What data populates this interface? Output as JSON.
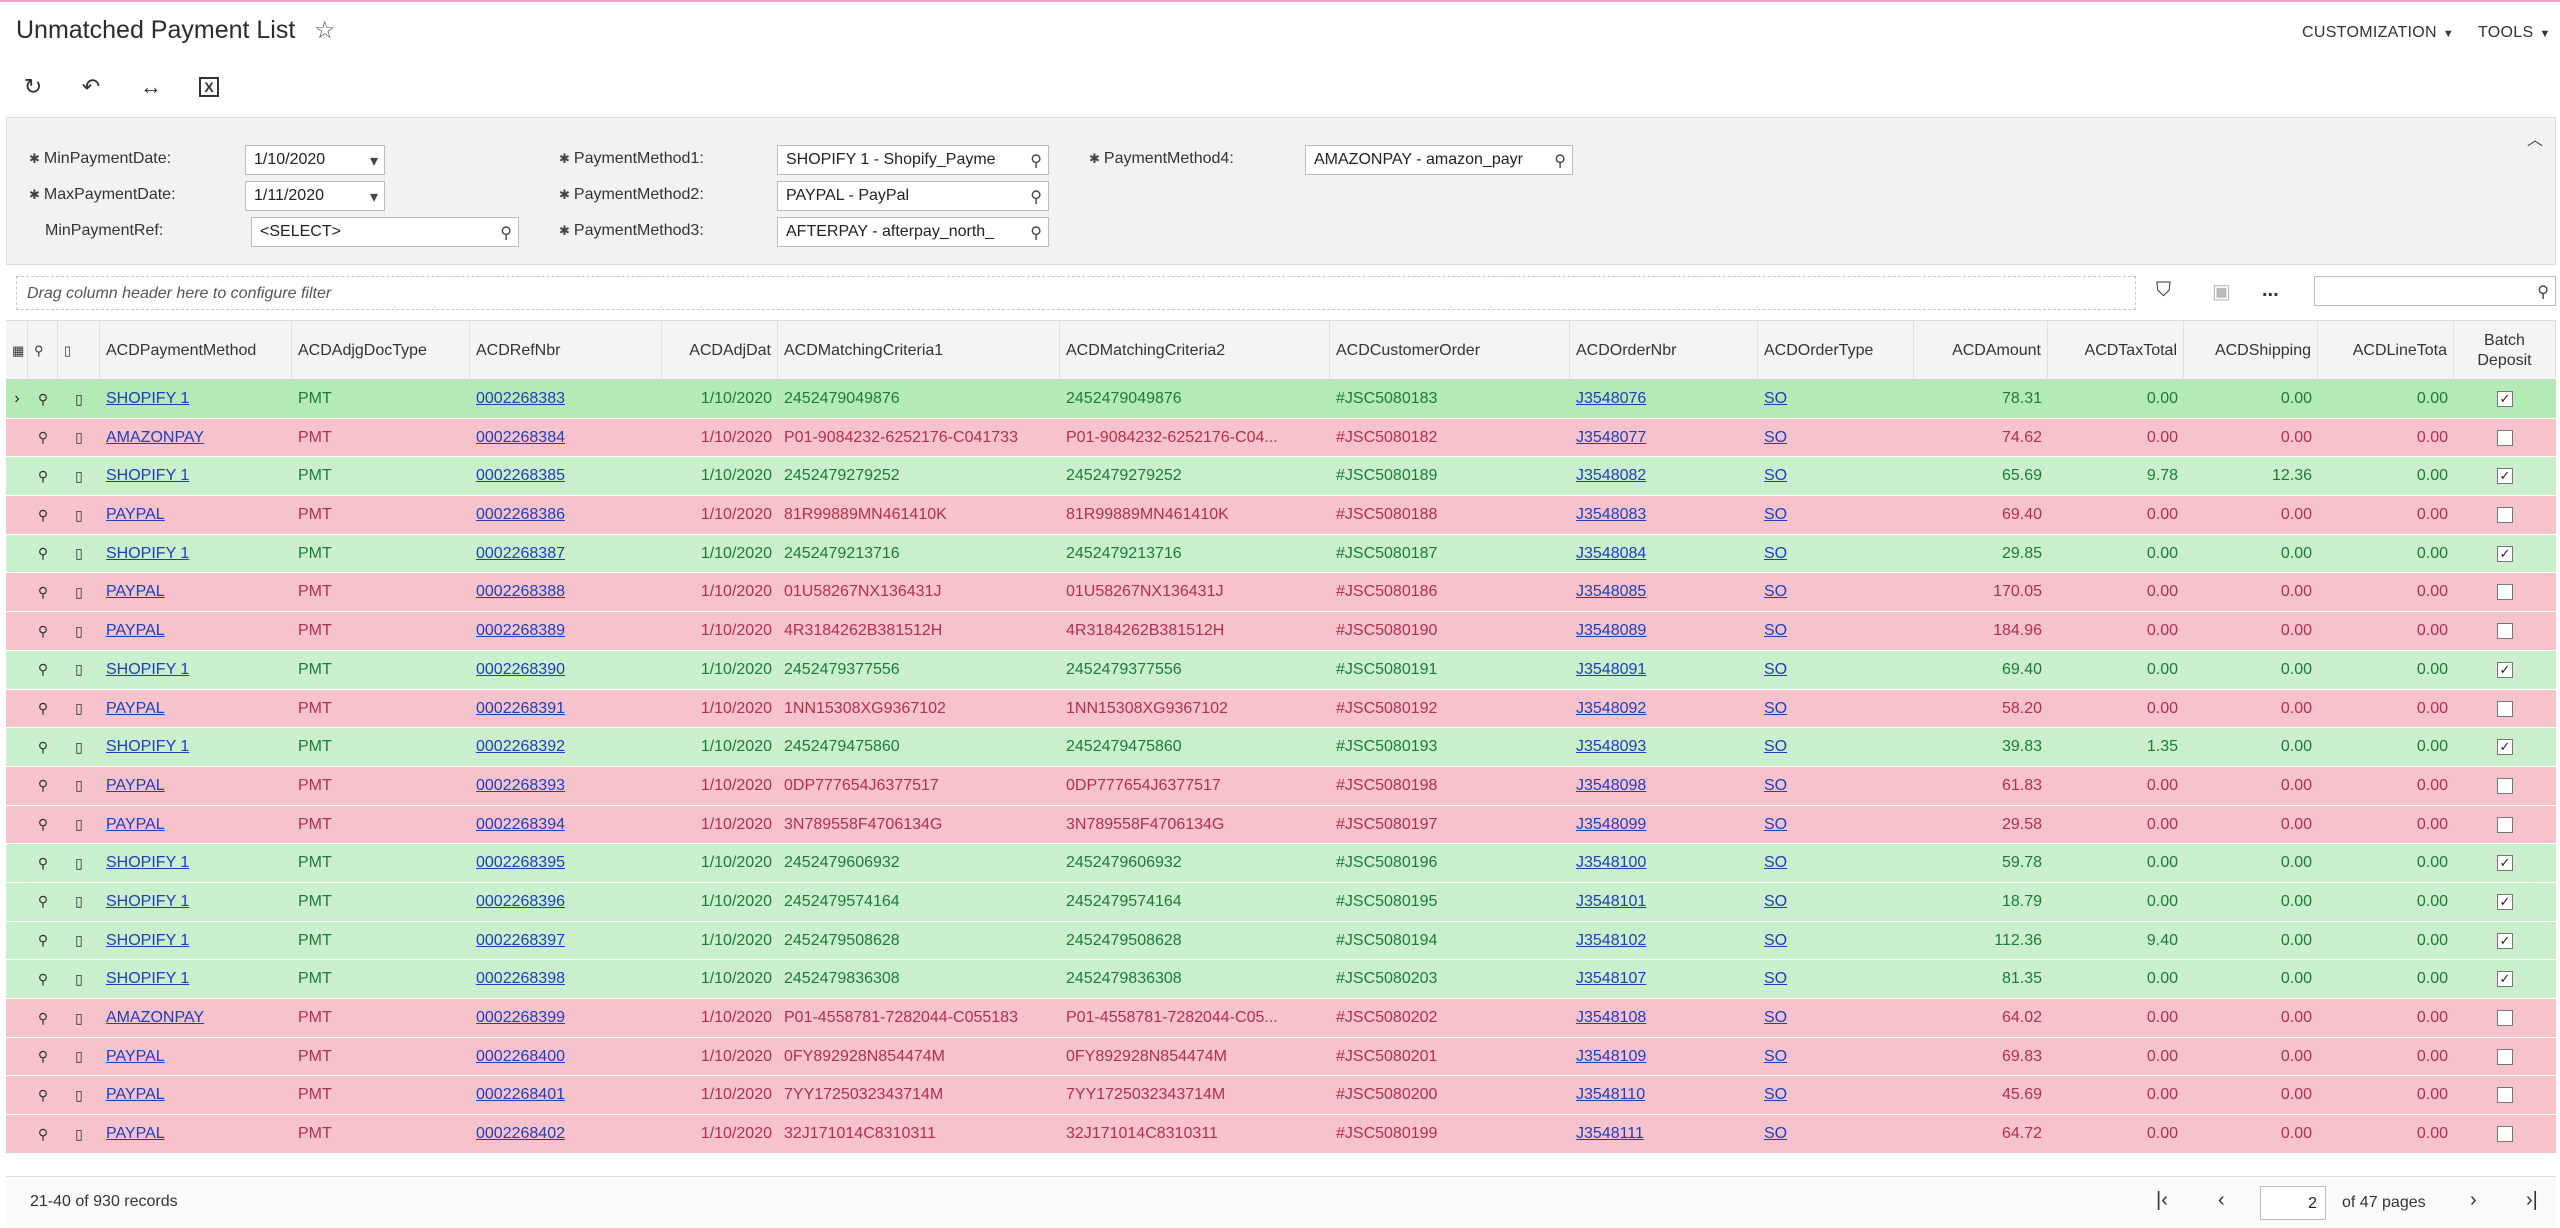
{
  "header": {
    "title": "Unmatched Payment List",
    "menus": [
      "CUSTOMIZATION",
      "TOOLS"
    ]
  },
  "toolbar": {
    "buttons": [
      "refresh-icon",
      "undo-icon",
      "fit-columns-icon",
      "excel-export-icon"
    ]
  },
  "filters": {
    "min_payment_date_label": "MinPaymentDate:",
    "min_payment_date": "1/10/2020",
    "max_payment_date_label": "MaxPaymentDate:",
    "max_payment_date": "1/11/2020",
    "min_payment_ref_label": "MinPaymentRef:",
    "min_payment_ref": "<SELECT>",
    "pm1_label": "PaymentMethod1:",
    "pm1": "SHOPIFY 1 - Shopify_Payme",
    "pm2_label": "PaymentMethod2:",
    "pm2": "PAYPAL - PayPal",
    "pm3_label": "PaymentMethod3:",
    "pm3": "AFTERPAY - afterpay_north_",
    "pm4_label": "PaymentMethod4:",
    "pm4": "AMAZONPAY - amazon_payr"
  },
  "grid_toolbar": {
    "drag_hint": "Drag column header here to configure filter",
    "more": "..."
  },
  "columns": {
    "payment_method": "ACDPaymentMethod",
    "adj_doc_type": "ACDAdjgDocType",
    "ref_nbr": "ACDRefNbr",
    "adj_date": "ACDAdjDat",
    "crit1": "ACDMatchingCriteria1",
    "crit2": "ACDMatchingCriteria2",
    "customer_order": "ACDCustomerOrder",
    "order_nbr": "ACDOrderNbr",
    "order_type": "ACDOrderType",
    "amount": "ACDAmount",
    "tax_total": "ACDTaxTotal",
    "shipping": "ACDShipping",
    "line_total": "ACDLineTota",
    "batch_deposit_1": "Batch",
    "batch_deposit_2": "Deposit"
  },
  "rows": [
    {
      "status": "green",
      "method": "SHOPIFY 1",
      "doc": "PMT",
      "ref": "0002268383",
      "date": "1/10/2020",
      "c1": "2452479049876",
      "c2": "2452479049876",
      "cust": "#JSC5080183",
      "order": "J3548076",
      "type": "SO",
      "amount": "78.31",
      "tax": "0.00",
      "ship": "0.00",
      "line": "0.00",
      "batch": true
    },
    {
      "status": "red",
      "method": "AMAZONPAY",
      "doc": "PMT",
      "ref": "0002268384",
      "date": "1/10/2020",
      "c1": "P01-9084232-6252176-C041733",
      "c2": "P01-9084232-6252176-C04...",
      "cust": "#JSC5080182",
      "order": "J3548077",
      "type": "SO",
      "amount": "74.62",
      "tax": "0.00",
      "ship": "0.00",
      "line": "0.00",
      "batch": false
    },
    {
      "status": "green",
      "method": "SHOPIFY 1",
      "doc": "PMT",
      "ref": "0002268385",
      "date": "1/10/2020",
      "c1": "2452479279252",
      "c2": "2452479279252",
      "cust": "#JSC5080189",
      "order": "J3548082",
      "type": "SO",
      "amount": "65.69",
      "tax": "9.78",
      "ship": "12.36",
      "line": "0.00",
      "batch": true
    },
    {
      "status": "red",
      "method": "PAYPAL",
      "doc": "PMT",
      "ref": "0002268386",
      "date": "1/10/2020",
      "c1": "81R99889MN461410K",
      "c2": "81R99889MN461410K",
      "cust": "#JSC5080188",
      "order": "J3548083",
      "type": "SO",
      "amount": "69.40",
      "tax": "0.00",
      "ship": "0.00",
      "line": "0.00",
      "batch": false
    },
    {
      "status": "green",
      "method": "SHOPIFY 1",
      "doc": "PMT",
      "ref": "0002268387",
      "date": "1/10/2020",
      "c1": "2452479213716",
      "c2": "2452479213716",
      "cust": "#JSC5080187",
      "order": "J3548084",
      "type": "SO",
      "amount": "29.85",
      "tax": "0.00",
      "ship": "0.00",
      "line": "0.00",
      "batch": true
    },
    {
      "status": "red",
      "method": "PAYPAL",
      "doc": "PMT",
      "ref": "0002268388",
      "date": "1/10/2020",
      "c1": "01U58267NX136431J",
      "c2": "01U58267NX136431J",
      "cust": "#JSC5080186",
      "order": "J3548085",
      "type": "SO",
      "amount": "170.05",
      "tax": "0.00",
      "ship": "0.00",
      "line": "0.00",
      "batch": false
    },
    {
      "status": "red",
      "method": "PAYPAL",
      "doc": "PMT",
      "ref": "0002268389",
      "date": "1/10/2020",
      "c1": "4R3184262B381512H",
      "c2": "4R3184262B381512H",
      "cust": "#JSC5080190",
      "order": "J3548089",
      "type": "SO",
      "amount": "184.96",
      "tax": "0.00",
      "ship": "0.00",
      "line": "0.00",
      "batch": false
    },
    {
      "status": "green",
      "method": "SHOPIFY 1",
      "doc": "PMT",
      "ref": "0002268390",
      "date": "1/10/2020",
      "c1": "2452479377556",
      "c2": "2452479377556",
      "cust": "#JSC5080191",
      "order": "J3548091",
      "type": "SO",
      "amount": "69.40",
      "tax": "0.00",
      "ship": "0.00",
      "line": "0.00",
      "batch": true
    },
    {
      "status": "red",
      "method": "PAYPAL",
      "doc": "PMT",
      "ref": "0002268391",
      "date": "1/10/2020",
      "c1": "1NN15308XG9367102",
      "c2": "1NN15308XG9367102",
      "cust": "#JSC5080192",
      "order": "J3548092",
      "type": "SO",
      "amount": "58.20",
      "tax": "0.00",
      "ship": "0.00",
      "line": "0.00",
      "batch": false
    },
    {
      "status": "green",
      "method": "SHOPIFY 1",
      "doc": "PMT",
      "ref": "0002268392",
      "date": "1/10/2020",
      "c1": "2452479475860",
      "c2": "2452479475860",
      "cust": "#JSC5080193",
      "order": "J3548093",
      "type": "SO",
      "amount": "39.83",
      "tax": "1.35",
      "ship": "0.00",
      "line": "0.00",
      "batch": true
    },
    {
      "status": "red",
      "method": "PAYPAL",
      "doc": "PMT",
      "ref": "0002268393",
      "date": "1/10/2020",
      "c1": "0DP777654J6377517",
      "c2": "0DP777654J6377517",
      "cust": "#JSC5080198",
      "order": "J3548098",
      "type": "SO",
      "amount": "61.83",
      "tax": "0.00",
      "ship": "0.00",
      "line": "0.00",
      "batch": false
    },
    {
      "status": "red",
      "method": "PAYPAL",
      "doc": "PMT",
      "ref": "0002268394",
      "date": "1/10/2020",
      "c1": "3N789558F4706134G",
      "c2": "3N789558F4706134G",
      "cust": "#JSC5080197",
      "order": "J3548099",
      "type": "SO",
      "amount": "29.58",
      "tax": "0.00",
      "ship": "0.00",
      "line": "0.00",
      "batch": false
    },
    {
      "status": "green",
      "method": "SHOPIFY 1",
      "doc": "PMT",
      "ref": "0002268395",
      "date": "1/10/2020",
      "c1": "2452479606932",
      "c2": "2452479606932",
      "cust": "#JSC5080196",
      "order": "J3548100",
      "type": "SO",
      "amount": "59.78",
      "tax": "0.00",
      "ship": "0.00",
      "line": "0.00",
      "batch": true
    },
    {
      "status": "green",
      "method": "SHOPIFY 1",
      "doc": "PMT",
      "ref": "0002268396",
      "date": "1/10/2020",
      "c1": "2452479574164",
      "c2": "2452479574164",
      "cust": "#JSC5080195",
      "order": "J3548101",
      "type": "SO",
      "amount": "18.79",
      "tax": "0.00",
      "ship": "0.00",
      "line": "0.00",
      "batch": true
    },
    {
      "status": "green",
      "method": "SHOPIFY 1",
      "doc": "PMT",
      "ref": "0002268397",
      "date": "1/10/2020",
      "c1": "2452479508628",
      "c2": "2452479508628",
      "cust": "#JSC5080194",
      "order": "J3548102",
      "type": "SO",
      "amount": "112.36",
      "tax": "9.40",
      "ship": "0.00",
      "line": "0.00",
      "batch": true
    },
    {
      "status": "green",
      "method": "SHOPIFY 1",
      "doc": "PMT",
      "ref": "0002268398",
      "date": "1/10/2020",
      "c1": "2452479836308",
      "c2": "2452479836308",
      "cust": "#JSC5080203",
      "order": "J3548107",
      "type": "SO",
      "amount": "81.35",
      "tax": "0.00",
      "ship": "0.00",
      "line": "0.00",
      "batch": true
    },
    {
      "status": "red",
      "method": "AMAZONPAY",
      "doc": "PMT",
      "ref": "0002268399",
      "date": "1/10/2020",
      "c1": "P01-4558781-7282044-C055183",
      "c2": "P01-4558781-7282044-C05...",
      "cust": "#JSC5080202",
      "order": "J3548108",
      "type": "SO",
      "amount": "64.02",
      "tax": "0.00",
      "ship": "0.00",
      "line": "0.00",
      "batch": false
    },
    {
      "status": "red",
      "method": "PAYPAL",
      "doc": "PMT",
      "ref": "0002268400",
      "date": "1/10/2020",
      "c1": "0FY892928N854474M",
      "c2": "0FY892928N854474M",
      "cust": "#JSC5080201",
      "order": "J3548109",
      "type": "SO",
      "amount": "69.83",
      "tax": "0.00",
      "ship": "0.00",
      "line": "0.00",
      "batch": false
    },
    {
      "status": "red",
      "method": "PAYPAL",
      "doc": "PMT",
      "ref": "0002268401",
      "date": "1/10/2020",
      "c1": "7YY1725032343714M",
      "c2": "7YY1725032343714M",
      "cust": "#JSC5080200",
      "order": "J3548110",
      "type": "SO",
      "amount": "45.69",
      "tax": "0.00",
      "ship": "0.00",
      "line": "0.00",
      "batch": false
    },
    {
      "status": "red",
      "method": "PAYPAL",
      "doc": "PMT",
      "ref": "0002268402",
      "date": "1/10/2020",
      "c1": "32J171014C8310311",
      "c2": "32J171014C8310311",
      "cust": "#JSC5080199",
      "order": "J3548111",
      "type": "SO",
      "amount": "64.72",
      "tax": "0.00",
      "ship": "0.00",
      "line": "0.00",
      "batch": false
    }
  ],
  "footer": {
    "records": "21-40 of 930 records",
    "page": "2",
    "of_pages": "of 47 pages"
  }
}
